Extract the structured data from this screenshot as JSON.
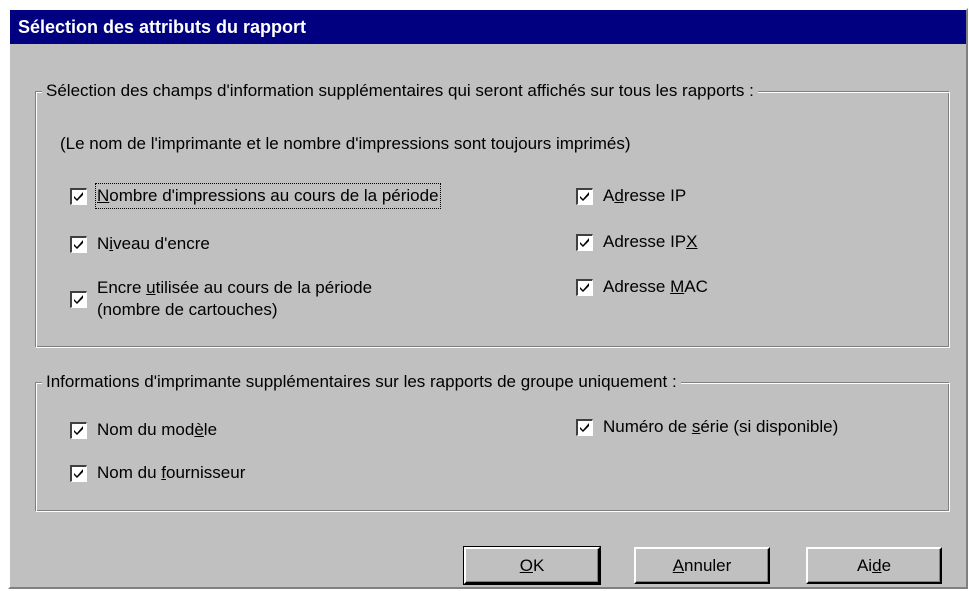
{
  "window": {
    "title": "Sélection des attributs du rapport"
  },
  "group1": {
    "legend": "Sélection des champs d'information supplémentaires qui seront affichés sur tous les rapports :",
    "note": "(Le nom de l'imprimante et le nombre d'impressions sont toujours imprimés)",
    "left": [
      {
        "pre": "",
        "u": "N",
        "post": "ombre d'impressions au cours de la période",
        "checked": true
      },
      {
        "pre": "N",
        "u": "i",
        "post": "veau d'encre",
        "checked": true
      },
      {
        "pre": "Encre ",
        "u": "u",
        "post": "tilisée au cours de la période\n(nombre de cartouches)",
        "checked": true
      }
    ],
    "right": [
      {
        "pre": "A",
        "u": "d",
        "post": "resse IP",
        "checked": true
      },
      {
        "pre": "Adresse IP",
        "u": "X",
        "post": "",
        "checked": true
      },
      {
        "pre": "Adresse ",
        "u": "M",
        "post": "AC",
        "checked": true
      }
    ]
  },
  "group2": {
    "legend": "Informations d'imprimante supplémentaires sur les rapports de groupe uniquement :",
    "left": [
      {
        "pre": "Nom du mod",
        "u": "è",
        "post": "le",
        "checked": true
      },
      {
        "pre": "Nom du ",
        "u": "f",
        "post": "ournisseur",
        "checked": true
      }
    ],
    "right": [
      {
        "pre": "Numéro de ",
        "u": "s",
        "post": "érie (si disponible)",
        "checked": true
      }
    ]
  },
  "buttons": {
    "ok": {
      "pre": "",
      "u": "O",
      "post": "K"
    },
    "cancel": {
      "pre": "",
      "u": "A",
      "post": "nnuler"
    },
    "help": {
      "pre": "Ai",
      "u": "d",
      "post": "e"
    }
  }
}
